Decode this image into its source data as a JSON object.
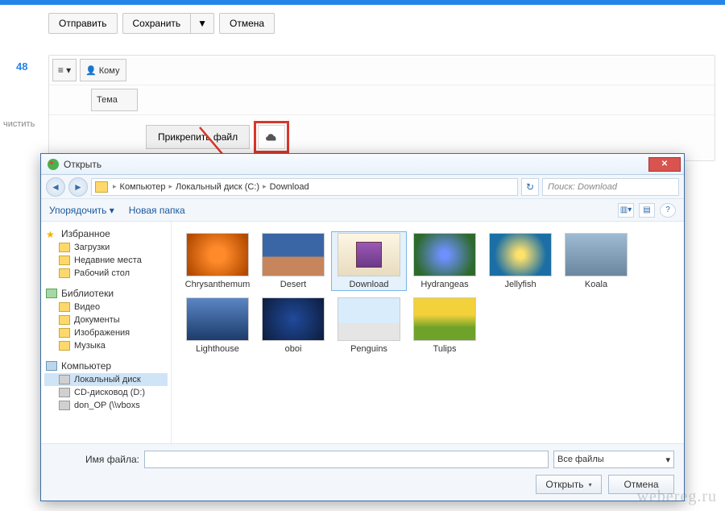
{
  "toolbar": {
    "send": "Отправить",
    "save": "Сохранить",
    "cancel": "Отмена"
  },
  "side": {
    "count": "48",
    "clear": "чистить"
  },
  "compose": {
    "menu_glyph": "≡ ▾",
    "to_label": "👤 Кому",
    "subject_label": "Тема",
    "attach_label": "Прикрепить файл"
  },
  "dialog": {
    "title": "Открыть",
    "close_glyph": "✕",
    "breadcrumbs": [
      "Компьютер",
      "Локальный диск (C:)",
      "Download"
    ],
    "search_placeholder": "Поиск: Download",
    "organize": "Упорядочить ▾",
    "new_folder": "Новая папка",
    "tree": {
      "favorites": "Избранное",
      "fav_items": [
        "Загрузки",
        "Недавние места",
        "Рабочий стол"
      ],
      "libraries": "Библиотеки",
      "lib_items": [
        "Видео",
        "Документы",
        "Изображения",
        "Музыка"
      ],
      "computer": "Компьютер",
      "comp_items": [
        "Локальный диск",
        "CD-дисковод (D:)",
        "don_OP (\\\\vboxs"
      ]
    },
    "files": [
      {
        "name": "Chrysanthemum"
      },
      {
        "name": "Desert"
      },
      {
        "name": "Download"
      },
      {
        "name": "Hydrangeas"
      },
      {
        "name": "Jellyfish"
      },
      {
        "name": "Koala"
      },
      {
        "name": "Lighthouse"
      },
      {
        "name": "oboi"
      },
      {
        "name": "Penguins"
      },
      {
        "name": "Tulips"
      }
    ],
    "filename_label": "Имя файла:",
    "filter": "Все файлы",
    "open_btn": "Открыть",
    "cancel_btn": "Отмена"
  },
  "watermark": "webereg.ru"
}
